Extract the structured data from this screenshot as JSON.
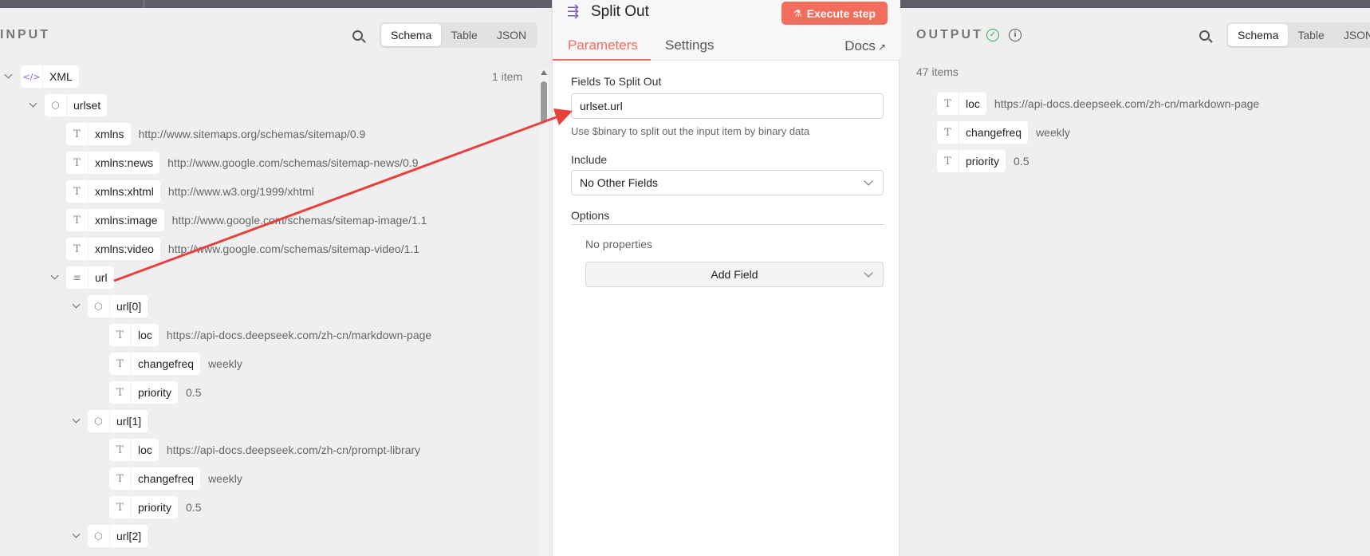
{
  "input": {
    "title": "INPUT",
    "view_tabs": [
      "Schema",
      "Table",
      "JSON"
    ],
    "active_tab": "Schema",
    "root": {
      "label": "XML",
      "count": "1 item"
    },
    "urlset": "urlset",
    "fields": [
      {
        "key": "xmlns",
        "value": "http://www.sitemaps.org/schemas/sitemap/0.9"
      },
      {
        "key": "xmlns:news",
        "value": "http://www.google.com/schemas/sitemap-news/0.9"
      },
      {
        "key": "xmlns:xhtml",
        "value": "http://www.w3.org/1999/xhtml"
      },
      {
        "key": "xmlns:image",
        "value": "http://www.google.com/schemas/sitemap-image/1.1"
      },
      {
        "key": "xmlns:video",
        "value": "http://www.google.com/schemas/sitemap-video/1.1"
      }
    ],
    "url": "url",
    "url_items": [
      {
        "label": "url[0]",
        "loc": "https://api-docs.deepseek.com/zh-cn/markdown-page",
        "changefreq": "weekly",
        "priority": "0.5"
      },
      {
        "label": "url[1]",
        "loc": "https://api-docs.deepseek.com/zh-cn/prompt-library",
        "changefreq": "weekly",
        "priority": "0.5"
      },
      {
        "label": "url[2]"
      }
    ],
    "keys": {
      "loc": "loc",
      "changefreq": "changefreq",
      "priority": "priority"
    }
  },
  "node": {
    "title": "Split Out",
    "execute_label": "Execute step",
    "tabs": [
      "Parameters",
      "Settings"
    ],
    "docs_label": "Docs",
    "fields_label": "Fields To Split Out",
    "fields_value": "urlset.url",
    "fields_hint": "Use $binary to split out the input item by binary data",
    "include_label": "Include",
    "include_value": "No Other Fields",
    "options_label": "Options",
    "no_properties": "No properties",
    "add_field": "Add Field"
  },
  "output": {
    "title": "OUTPUT",
    "count": "47 items",
    "view_tabs": [
      "Schema",
      "Table",
      "JSON"
    ],
    "fields": [
      {
        "key": "loc",
        "value": "https://api-docs.deepseek.com/zh-cn/markdown-page"
      },
      {
        "key": "changefreq",
        "value": "weekly"
      },
      {
        "key": "priority",
        "value": "0.5"
      }
    ]
  },
  "colors": {
    "accent": "#f26d5b",
    "success": "#2fa84f",
    "node_icon": "#7c5cbf",
    "arrow": "#e8403a"
  }
}
